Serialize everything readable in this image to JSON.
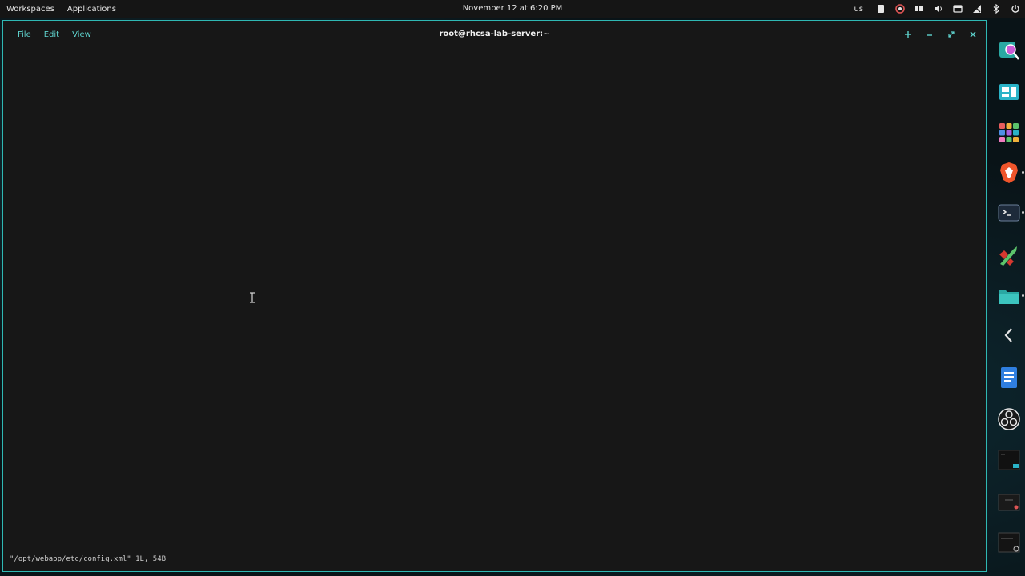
{
  "topbar": {
    "workspaces_label": "Workspaces",
    "applications_label": "Applications",
    "clock": "November 12 at 6:20 PM",
    "keyboard_layout": "us",
    "tray_icons": [
      "clipboard-icon",
      "updates-icon",
      "display-icon",
      "volume-icon",
      "screenshot-icon",
      "network-icon",
      "bluetooth-icon",
      "power-icon"
    ]
  },
  "terminal": {
    "title": "root@rhcsa-lab-server:~",
    "menus": [
      "File",
      "Edit",
      "View"
    ],
    "controls": [
      "new-tab-icon",
      "minimize-icon",
      "maximize-icon",
      "close-icon"
    ],
    "status_line": "\"/opt/webapp/etc/config.xml\" 1L, 54B"
  },
  "dock": {
    "items": [
      "search-app-icon",
      "window-manager-icon",
      "app-grid-icon",
      "brave-browser-icon",
      "terminal-app-icon",
      "text-editor-icon",
      "files-app-icon",
      "collapse-icon",
      "writer-icon",
      "obs-icon",
      "window-thumbnail-1",
      "window-thumbnail-2",
      "window-thumbnail-3"
    ]
  },
  "colors": {
    "accent": "#2fb8b3",
    "menu_text": "#5fd3ce",
    "terminal_bg": "#171717",
    "topbar_bg": "#151515"
  }
}
